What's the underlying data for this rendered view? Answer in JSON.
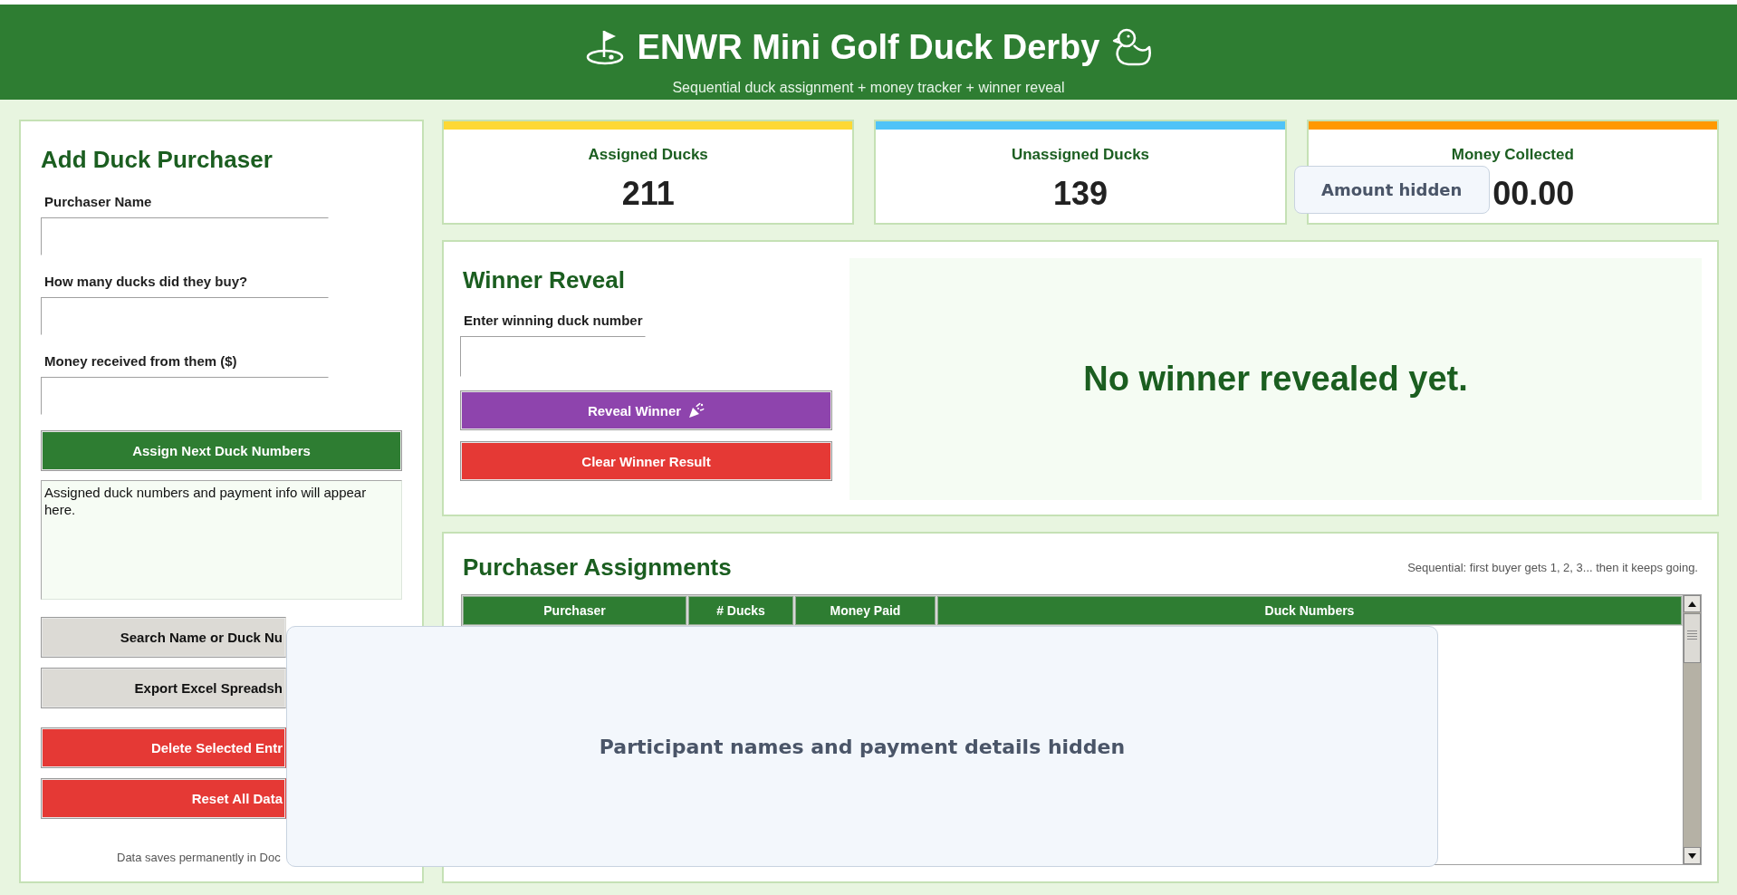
{
  "header": {
    "title": "ENWR Mini Golf Duck Derby",
    "subtitle": "Sequential duck assignment + money tracker + winner reveal"
  },
  "add_purchaser": {
    "title": "Add Duck Purchaser",
    "fields": [
      {
        "label": "Purchaser Name"
      },
      {
        "label": "How many ducks did they buy?"
      },
      {
        "label": "Money received from them ($)"
      }
    ],
    "assign_button": {
      "label": "Assign Next Duck Numbers",
      "kind": "primary"
    },
    "output_text": "Assigned duck numbers and payment info will appear here.",
    "buttons": [
      {
        "label": "Search Name or Duck Nu",
        "kind": "neutral"
      },
      {
        "label": "Export Excel Spreadsh",
        "kind": "neutral"
      },
      {
        "label": "Delete Selected Entr",
        "kind": "danger"
      },
      {
        "label": "Reset All Data",
        "kind": "danger"
      }
    ],
    "footer_note": "Data saves permanently in Doc"
  },
  "stats": [
    {
      "label": "Assigned Ducks",
      "value": "211",
      "color": "#fdd835"
    },
    {
      "label": "Unassigned Ducks",
      "value": "139",
      "color": "#4fc3f7"
    },
    {
      "label": "Money Collected",
      "value": "00.00",
      "color": "#ff9800",
      "overlay_note": "Amount hidden"
    }
  ],
  "winner_reveal": {
    "title": "Winner Reveal",
    "input_label": "Enter winning duck number",
    "buttons": [
      {
        "label": "Reveal Winner",
        "kind": "reveal"
      },
      {
        "label": "Clear Winner Result",
        "kind": "danger"
      }
    ],
    "result": "No winner revealed yet."
  },
  "assignments": {
    "title": "Purchaser Assignments",
    "note": "Sequential: first buyer gets 1, 2, 3... then it keeps going.",
    "table": {
      "columns": [
        "Purchaser",
        "# Ducks",
        "Money Paid",
        "Duck Numbers"
      ]
    },
    "overlay_note": "Participant names and payment details hidden"
  }
}
